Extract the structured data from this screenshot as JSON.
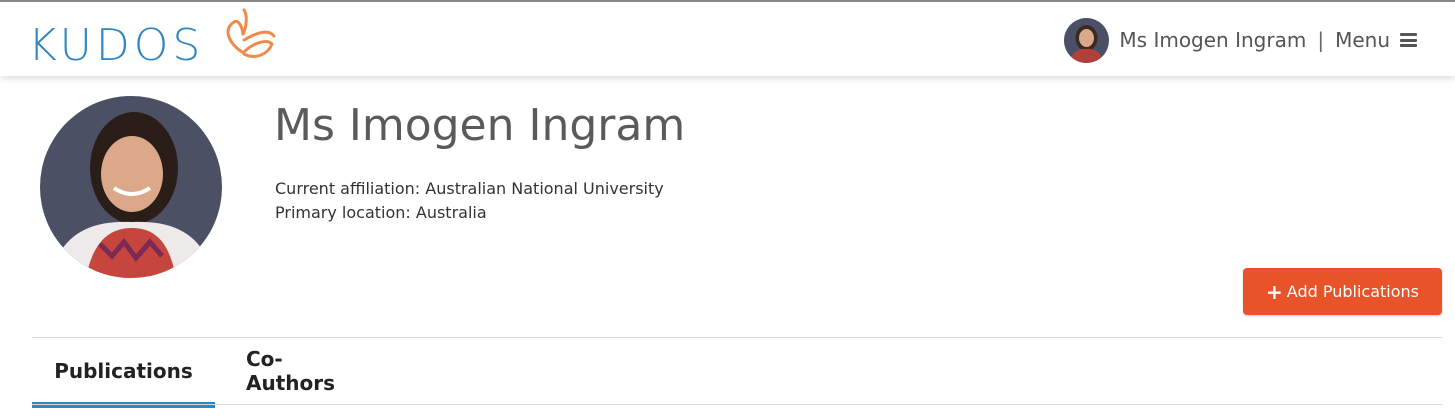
{
  "brand": {
    "logo_text": "KUDOS",
    "logo_color": "#2f86c2",
    "accent_color": "#f08a4b"
  },
  "header": {
    "user_name": "Ms Imogen Ingram",
    "separator": "|",
    "menu_label": "Menu"
  },
  "profile": {
    "name": "Ms Imogen Ingram",
    "affiliation": "Current affiliation: Australian National University",
    "location": "Primary location: Australia"
  },
  "actions": {
    "add_publications_label": "Add Publications",
    "add_publications_icon": "plus-icon",
    "button_color": "#e8532a"
  },
  "tabs": [
    {
      "label": "Publications",
      "active": true
    },
    {
      "label": "Co-Authors",
      "active": false
    }
  ]
}
